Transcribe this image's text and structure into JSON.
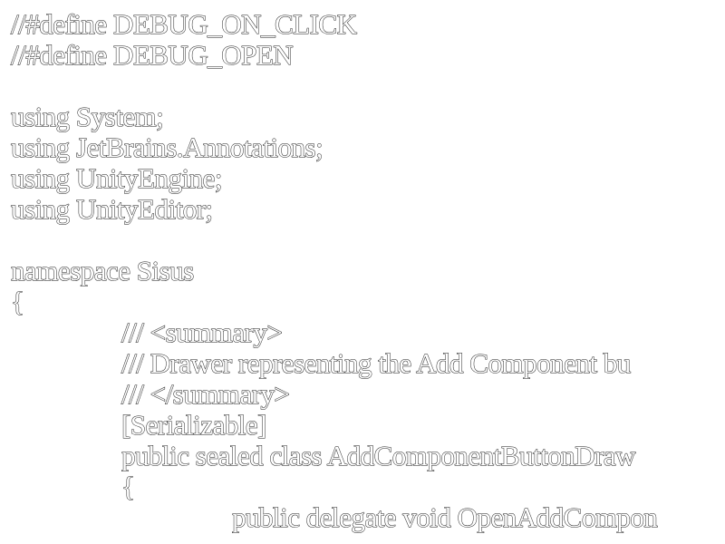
{
  "editor": {
    "lines": [
      {
        "indent": 0,
        "text": "//#define DEBUG_ON_CLICK"
      },
      {
        "indent": 0,
        "text": "//#define DEBUG_OPEN"
      },
      {
        "indent": 0,
        "text": ""
      },
      {
        "indent": 0,
        "text": "using System;"
      },
      {
        "indent": 0,
        "text": "using JetBrains.Annotations;"
      },
      {
        "indent": 0,
        "text": "using UnityEngine;"
      },
      {
        "indent": 0,
        "text": "using UnityEditor;"
      },
      {
        "indent": 0,
        "text": ""
      },
      {
        "indent": 0,
        "text": "namespace Sisus"
      },
      {
        "indent": 0,
        "text": "{"
      },
      {
        "indent": 1,
        "text": "/// <summary>"
      },
      {
        "indent": 1,
        "text": "/// Drawer representing the Add Component bu"
      },
      {
        "indent": 1,
        "text": "/// </summary>"
      },
      {
        "indent": 1,
        "text": "[Serializable]"
      },
      {
        "indent": 1,
        "text": "public sealed class AddComponentButtonDraw"
      },
      {
        "indent": 1,
        "text": "{"
      },
      {
        "indent": 2,
        "text": "public delegate void OpenAddCompon"
      }
    ]
  }
}
